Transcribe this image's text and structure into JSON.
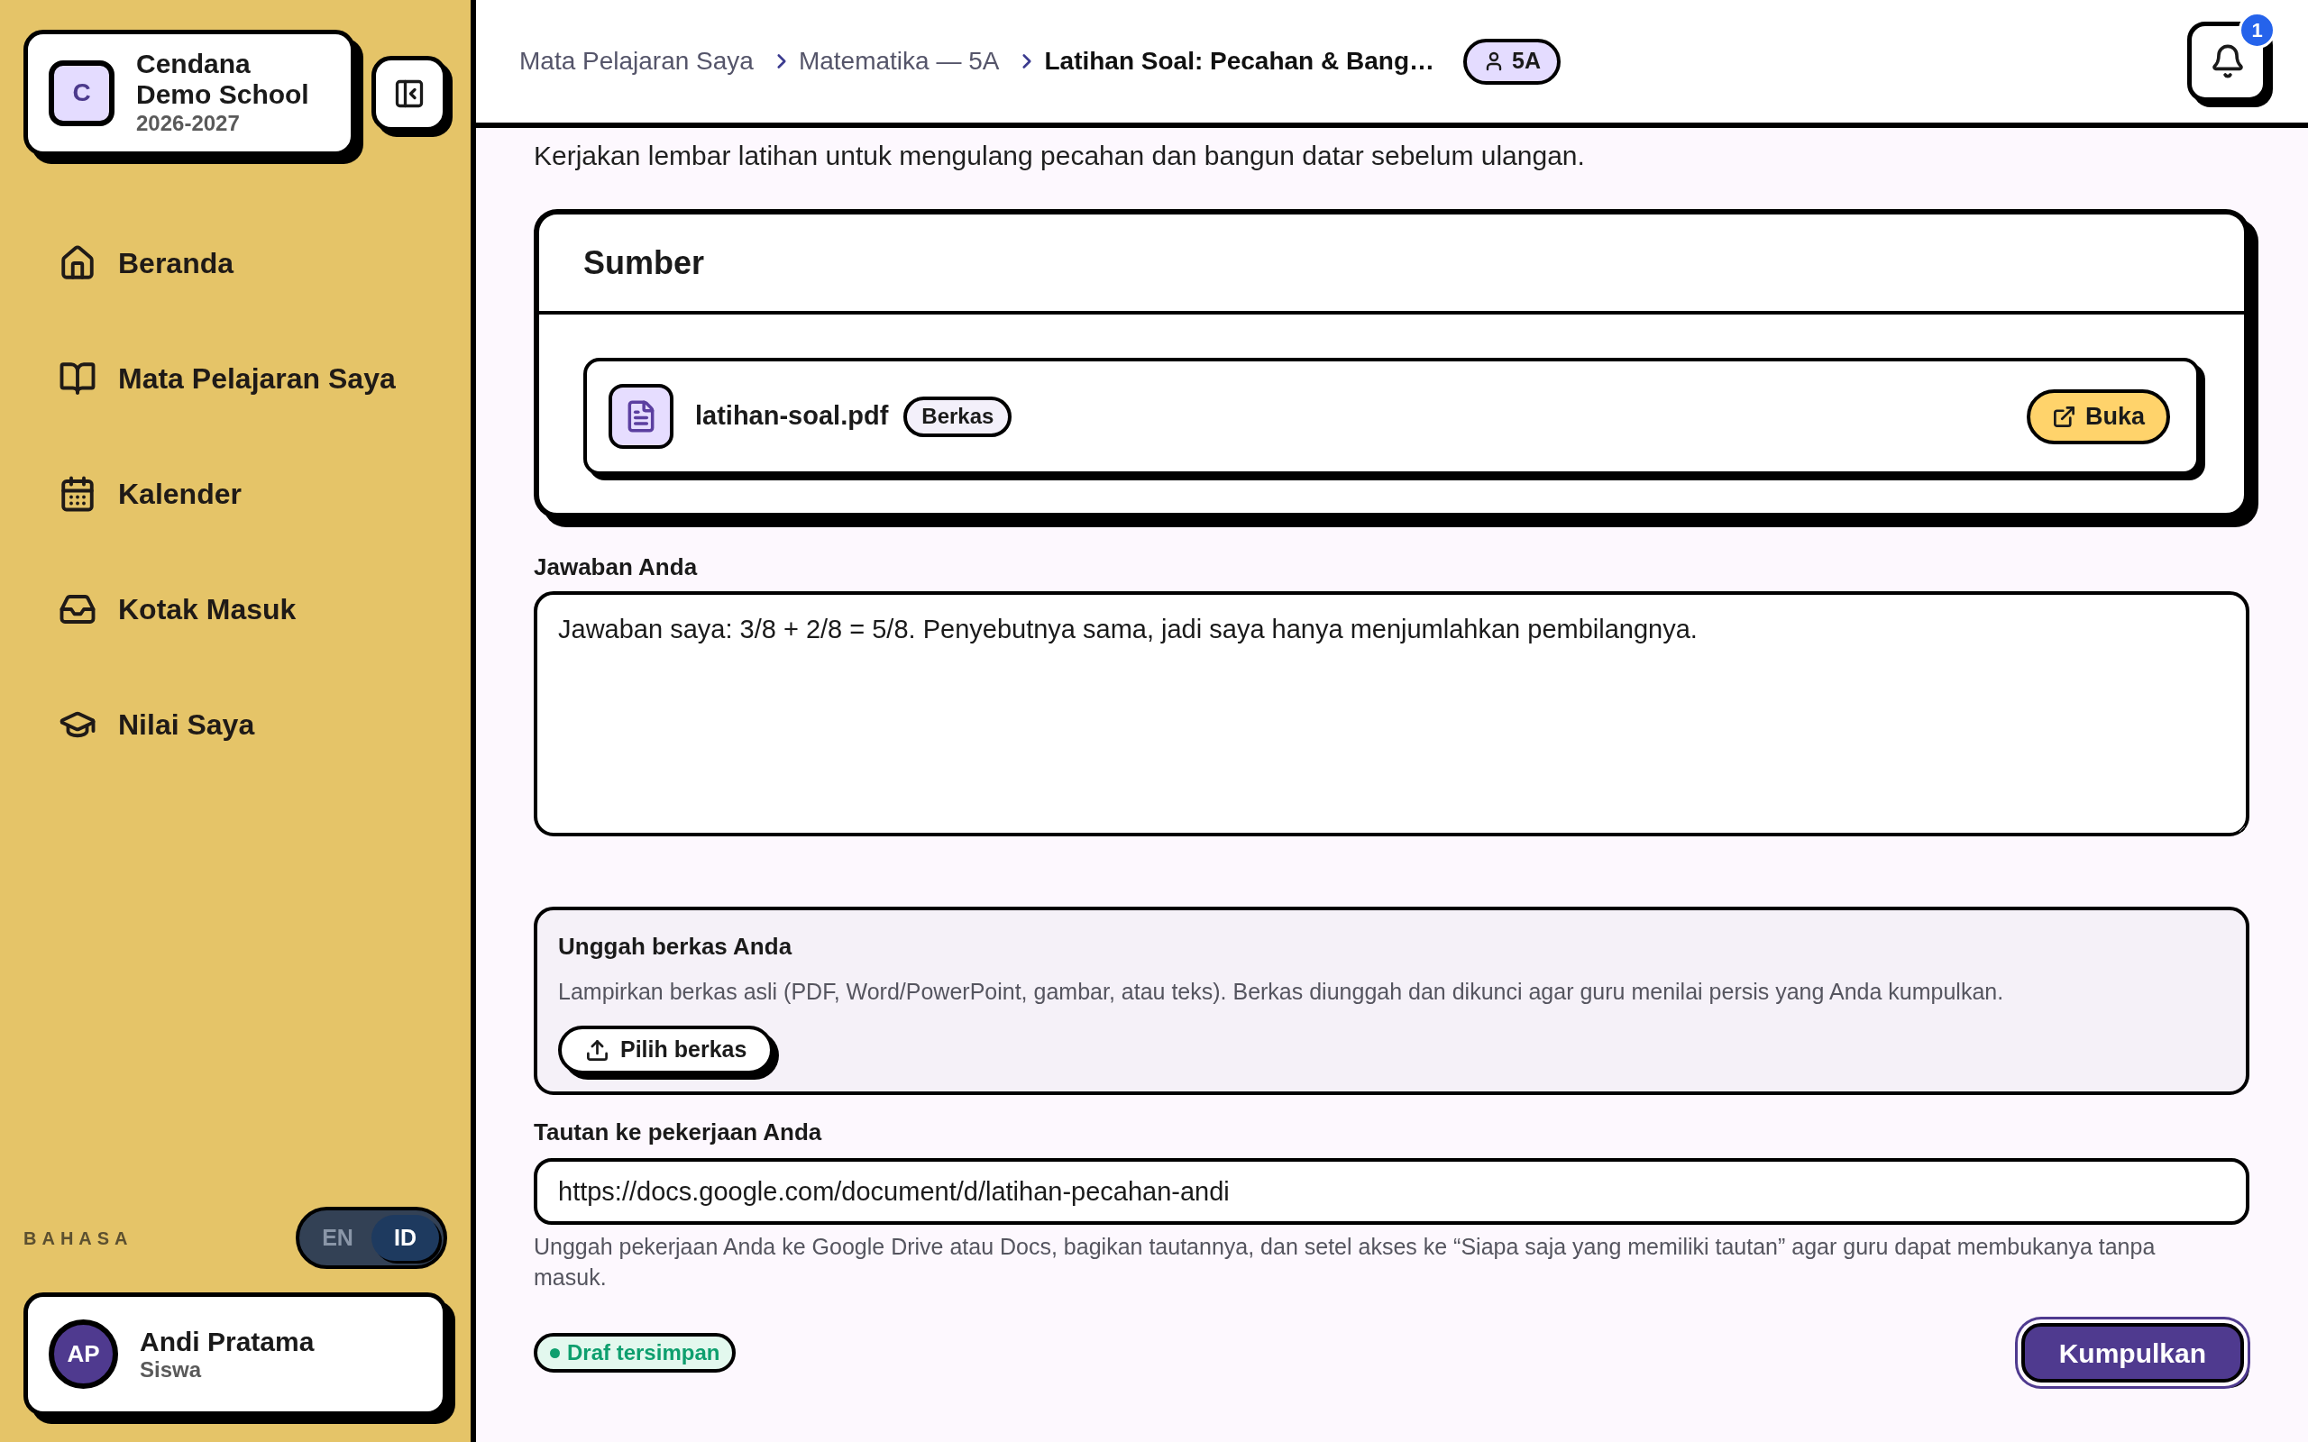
{
  "sidebar": {
    "school": {
      "initial": "C",
      "name": "Cendana Demo School",
      "year": "2026-2027"
    },
    "nav": [
      {
        "label": "Beranda"
      },
      {
        "label": "Mata Pelajaran Saya"
      },
      {
        "label": "Kalender"
      },
      {
        "label": "Kotak Masuk"
      },
      {
        "label": "Nilai Saya"
      }
    ],
    "language": {
      "label": "BAHASA",
      "options": [
        {
          "label": "EN",
          "selected": false
        },
        {
          "label": "ID",
          "selected": true
        }
      ]
    },
    "user": {
      "initials": "AP",
      "name": "Andi Pratama",
      "role": "Siswa"
    }
  },
  "header": {
    "breadcrumb": [
      {
        "label": "Mata Pelajaran Saya",
        "current": false
      },
      {
        "label": "Matematika — 5A",
        "current": false
      },
      {
        "label": "Latihan Soal: Pecahan & Bang…",
        "current": true
      }
    ],
    "class_badge": "5A",
    "notification_count": "1"
  },
  "description": "Kerjakan lembar latihan untuk mengulang pecahan dan bangun datar sebelum ulangan.",
  "resources": {
    "title": "Sumber",
    "files": [
      {
        "name": "latihan-soal.pdf",
        "type": "Berkas",
        "action": "Buka"
      }
    ]
  },
  "answer": {
    "label": "Jawaban Anda",
    "value": "Jawaban saya: 3/8 + 2/8 = 5/8. Penyebutnya sama, jadi saya hanya menjumlahkan pembilangnya."
  },
  "upload": {
    "title": "Unggah berkas Anda",
    "description": "Lampirkan berkas asli (PDF, Word/PowerPoint, gambar, atau teks). Berkas diunggah dan dikunci agar guru menilai persis yang Anda kumpulkan.",
    "button": "Pilih berkas"
  },
  "link": {
    "label": "Tautan ke pekerjaan Anda",
    "value": "https://docs.google.com/document/d/latihan-pecahan-andi",
    "help": "Unggah pekerjaan Anda ke Google Drive atau Docs, bagikan tautannya, dan setel akses ke “Siapa saja yang memiliki tautan” agar guru dapat membukanya tanpa masuk."
  },
  "draft_status": "Draf tersimpan",
  "submit": {
    "label": "Kumpulkan",
    "focused": true
  }
}
